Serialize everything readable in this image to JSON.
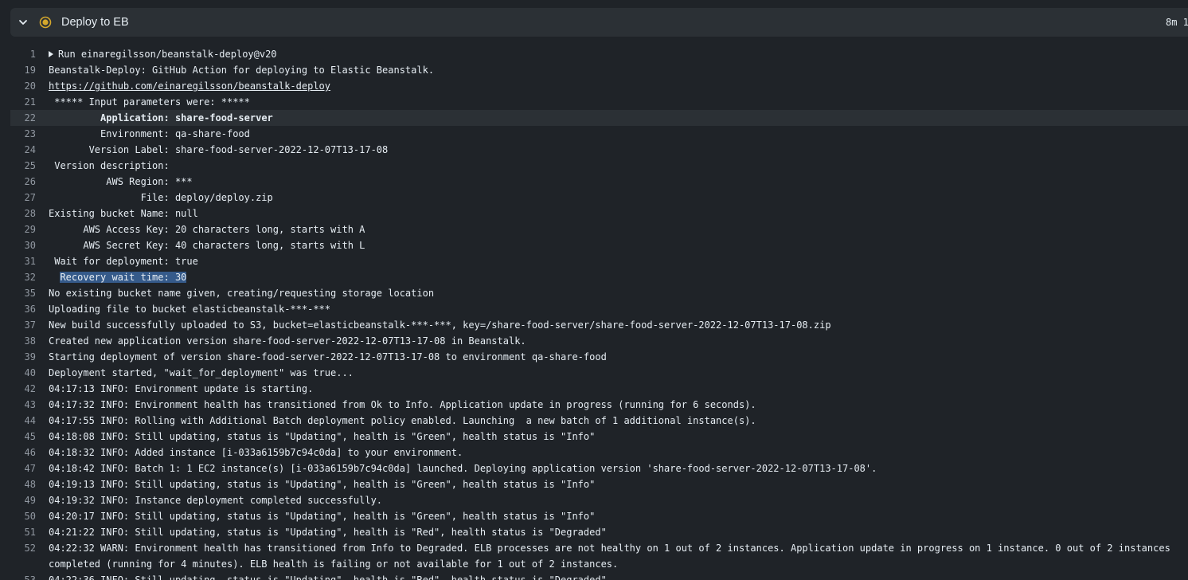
{
  "step": {
    "title": "Deploy to EB",
    "duration": "8m 1",
    "status_color": "#d4a72c"
  },
  "log_lines": [
    {
      "n": "1",
      "t": "Run einaregilsson/beanstalk-deploy@v20",
      "kind": "group"
    },
    {
      "n": "19",
      "t": "Beanstalk-Deploy: GitHub Action for deploying to Elastic Beanstalk."
    },
    {
      "n": "20",
      "t": "https://github.com/einaregilsson/beanstalk-deploy",
      "kind": "link"
    },
    {
      "n": "21",
      "t": " ***** Input parameters were: *****"
    },
    {
      "n": "22",
      "t": "         Application: share-food-server",
      "kind": "active"
    },
    {
      "n": "23",
      "t": "         Environment: qa-share-food"
    },
    {
      "n": "24",
      "t": "       Version Label: share-food-server-2022-12-07T13-17-08"
    },
    {
      "n": "25",
      "t": " Version description: "
    },
    {
      "n": "26",
      "t": "          AWS Region: ***"
    },
    {
      "n": "27",
      "t": "                File: deploy/deploy.zip"
    },
    {
      "n": "28",
      "t": "Existing bucket Name: null"
    },
    {
      "n": "29",
      "t": "      AWS Access Key: 20 characters long, starts with A"
    },
    {
      "n": "30",
      "t": "      AWS Secret Key: 40 characters long, starts with L"
    },
    {
      "n": "31",
      "t": " Wait for deployment: true"
    },
    {
      "n": "32",
      "t": "Recovery wait time: 30",
      "kind": "selected",
      "prefix": "  "
    },
    {
      "n": "35",
      "t": "No existing bucket name given, creating/requesting storage location"
    },
    {
      "n": "36",
      "t": "Uploading file to bucket elasticbeanstalk-***-***"
    },
    {
      "n": "37",
      "t": "New build successfully uploaded to S3, bucket=elasticbeanstalk-***-***, key=/share-food-server/share-food-server-2022-12-07T13-17-08.zip"
    },
    {
      "n": "38",
      "t": "Created new application version share-food-server-2022-12-07T13-17-08 in Beanstalk."
    },
    {
      "n": "39",
      "t": "Starting deployment of version share-food-server-2022-12-07T13-17-08 to environment qa-share-food"
    },
    {
      "n": "40",
      "t": "Deployment started, \"wait_for_deployment\" was true..."
    },
    {
      "n": "42",
      "t": "04:17:13 INFO: Environment update is starting."
    },
    {
      "n": "43",
      "t": "04:17:32 INFO: Environment health has transitioned from Ok to Info. Application update in progress (running for 6 seconds)."
    },
    {
      "n": "44",
      "t": "04:17:55 INFO: Rolling with Additional Batch deployment policy enabled. Launching  a new batch of 1 additional instance(s)."
    },
    {
      "n": "45",
      "t": "04:18:08 INFO: Still updating, status is \"Updating\", health is \"Green\", health status is \"Info\""
    },
    {
      "n": "46",
      "t": "04:18:32 INFO: Added instance [i-033a6159b7c94c0da] to your environment."
    },
    {
      "n": "47",
      "t": "04:18:42 INFO: Batch 1: 1 EC2 instance(s) [i-033a6159b7c94c0da] launched. Deploying application version 'share-food-server-2022-12-07T13-17-08'."
    },
    {
      "n": "48",
      "t": "04:19:13 INFO: Still updating, status is \"Updating\", health is \"Green\", health status is \"Info\""
    },
    {
      "n": "49",
      "t": "04:19:32 INFO: Instance deployment completed successfully."
    },
    {
      "n": "50",
      "t": "04:20:17 INFO: Still updating, status is \"Updating\", health is \"Green\", health status is \"Info\""
    },
    {
      "n": "51",
      "t": "04:21:22 INFO: Still updating, status is \"Updating\", health is \"Red\", health status is \"Degraded\""
    },
    {
      "n": "52",
      "t": "04:22:32 WARN: Environment health has transitioned from Info to Degraded. ELB processes are not healthy on 1 out of 2 instances. Application update in progress on 1 instance. 0 out of 2 instances completed (running for 4 minutes). ELB health is failing or not available for 1 out of 2 instances."
    },
    {
      "n": "53",
      "t": "04:22:36 INFO: Still updating, status is \"Updating\", health is \"Red\", health status is \"Degraded\""
    }
  ]
}
